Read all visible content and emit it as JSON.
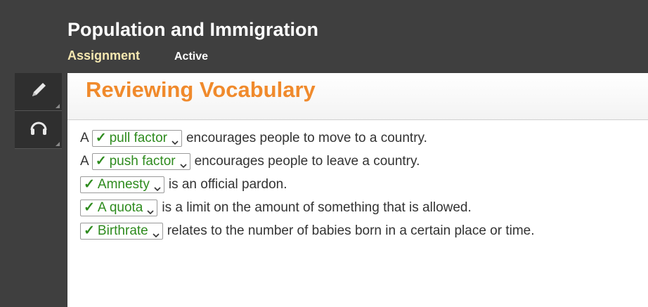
{
  "header": {
    "title": "Population and Immigration",
    "tab_assignment": "Assignment",
    "tab_active": "Active"
  },
  "toolbar": {
    "icons": [
      "pencil-icon",
      "headphones-icon"
    ]
  },
  "section": {
    "title": "Reviewing Vocabulary"
  },
  "rows": [
    {
      "pre": "A",
      "answer": "pull factor",
      "post": "encourages people to move to a country."
    },
    {
      "pre": "A",
      "answer": "push factor",
      "post": "encourages people to leave a country."
    },
    {
      "pre": "",
      "answer": "Amnesty",
      "post": "is an official pardon."
    },
    {
      "pre": "",
      "answer": "A quota",
      "post": "is a limit on the amount of something that is allowed."
    },
    {
      "pre": "",
      "answer": "Birthrate",
      "post": "relates to the number of babies born in a certain place or time."
    }
  ],
  "check_mark": "✓",
  "colors": {
    "header_bg": "#3f3f3f",
    "title_orange": "#f08a2c",
    "correct_green": "#2e8b1e",
    "assignment_tab": "#f5e7b0"
  }
}
